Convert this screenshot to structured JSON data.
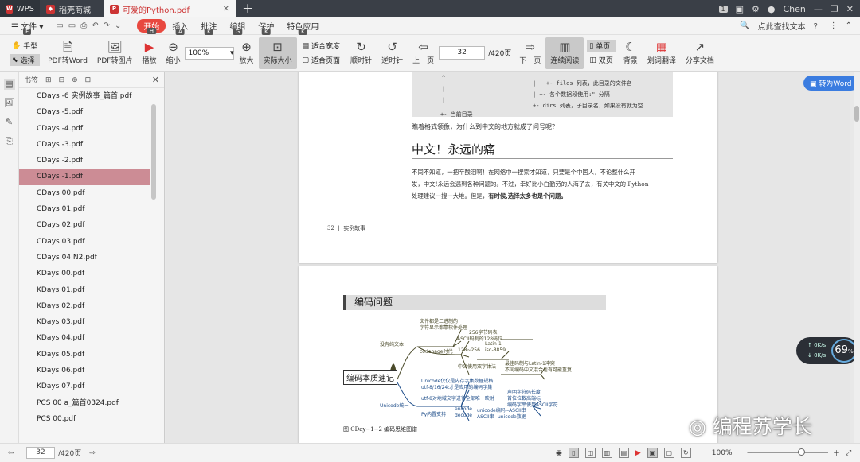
{
  "titlebar": {
    "wps_label": "WPS",
    "store_label": "稻壳商城",
    "doc_tab_label": "可爱的Python.pdf",
    "badge": "1",
    "user": "Chen"
  },
  "menubar": {
    "items": [
      {
        "label": "文件",
        "key": "F"
      },
      {
        "label": "开始",
        "key": "H"
      },
      {
        "label": "插入",
        "key": "A"
      },
      {
        "label": "批注",
        "key": "K"
      },
      {
        "label": "编辑",
        "key": "G"
      },
      {
        "label": "保护",
        "key": "K"
      },
      {
        "label": "特色应用",
        "key": "K"
      }
    ],
    "search_label": "点此查找文本"
  },
  "toolbar": {
    "hand": "手型",
    "select": "选择",
    "pdf2word": "PDF转Word",
    "pdf2img": "PDF转图片",
    "play": "播放",
    "zoom_out": "缩小",
    "zoom_value": "100%",
    "zoom_in": "放大",
    "actual_size": "实际大小",
    "fit_width": "适合宽度",
    "fit_page": "适合页面",
    "rotate_cw": "顺时针",
    "rotate_ccw": "逆时针",
    "prev_page": "上一页",
    "page_value": "32",
    "page_total": "/420页",
    "next_page": "下一页",
    "continuous": "连续阅读",
    "single": "单页",
    "double": "双页",
    "background": "背景",
    "translate": "划词翻译",
    "share": "分享文档"
  },
  "panel": {
    "title": "书签",
    "bookmarks": [
      "CDays -6 实例故事_篇首.pdf",
      "CDays -5.pdf",
      "CDays -4.pdf",
      "CDays -3.pdf",
      "CDays -2.pdf",
      "CDays -1.pdf",
      "CDays 00.pdf",
      "CDays 01.pdf",
      "CDays 02.pdf",
      "CDays 03.pdf",
      "CDays 04 N2.pdf",
      "KDays 00.pdf",
      "KDays 01.pdf",
      "KDays 02.pdf",
      "KDays 03.pdf",
      "KDays 04.pdf",
      "KDays 05.pdf",
      "KDays 06.pdf",
      "KDays 07.pdf",
      "PCS 00 a_篇首0324.pdf",
      "PCS 00.pdf"
    ],
    "selected_index": 5
  },
  "page1": {
    "code_lines": [
      "^ ^ ^",
      "| | +- files 列表，此目录的文件名",
      "| +- 各个数据段使用:\" 分隔",
      "+- dirs 列表，子目录名，如果没有就为空",
      "+- 当前目录"
    ],
    "question": "瞧着格式领像，为什么到中文的地方就成了问号呢？",
    "heading": "中文！永远的痛",
    "para_line1": "不同不知道，一把辛酸泪啊！在网络中一搜索才知道，只要是个中国人，不论整什么开",
    "para_line2": "发，中文!永远会遇到各种问题的。不过，幸好比小白勤劳的人海了去，有关中文的 Python",
    "para_line3_a": "处理建议一搜一大堆。但是，",
    "para_line3_b": "有时候,选择太多也是个问题。",
    "footer_num": "32",
    "footer_text": "实例故事"
  },
  "page2": {
    "section_title": "编码问题",
    "root": "编码本质速记",
    "nodes": {
      "plain": "没有纯文本",
      "bin1": "文件都是二进制的",
      "bin2": "字符显示都靠软件处理",
      "codepage": "codepage时代",
      "cp256": "256字节码表",
      "ascii": "ASCII码制的128码位",
      "latin": "Latin-1",
      "iso": "iso-8859",
      "r128": "128~256",
      "cn": "中文使用双字体法",
      "cn1": "最佳码制与Latin-1冲突",
      "cn2": "不同编码中文混合也有可能重复",
      "uni": "Unicode统一",
      "u1": "Unicode仅仅是内存字集数据规格",
      "u2": "utf-8/16/24:才是应用的编码字集",
      "u3": "utf-8对地域文字进行全部唯一映射",
      "u4": "声明字符码长度",
      "u5": "首位位数高端标",
      "u6": "编码字串使用ASCII字符",
      "py": "Py内置支持",
      "enc": "encode",
      "enc2": "unicode编码--ASCII串",
      "dec": "decode",
      "dec2": "ASCII串--unicode数据"
    },
    "caption": "图 CDay−1−2   编码思维图谱"
  },
  "overlays": {
    "to_word": "转为Word",
    "gauge_pct": "69",
    "gauge_up": "0K/s",
    "gauge_down": "0K/s",
    "watermark": "编程苏学长"
  },
  "statusbar": {
    "page_value": "32",
    "page_total": "/420页",
    "zoom": "100%"
  }
}
